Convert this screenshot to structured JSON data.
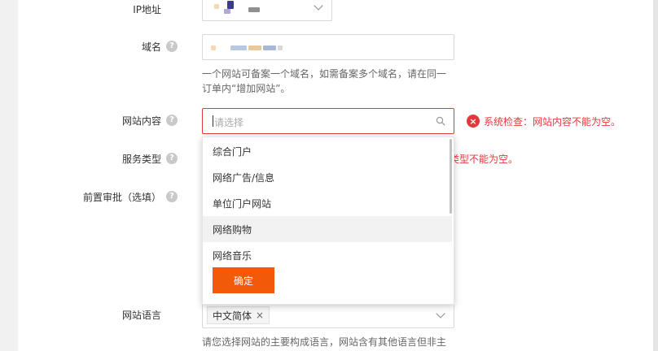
{
  "form": {
    "ip": {
      "label": "IP地址"
    },
    "domain": {
      "label": "域名",
      "hint_line1": "一个网站可备案一个域名，如需备案多个域名，请在同一",
      "hint_line2": "订单内“增加网站”。"
    },
    "site_content": {
      "label": "网站内容",
      "placeholder": "请选择",
      "error": "系统检查：网站内容不能为空。"
    },
    "service_type": {
      "label": "服务类型",
      "error_partial": "类型不能为空。"
    },
    "pre_approval": {
      "label": "前置审批（选填）"
    },
    "site_language": {
      "label": "网站语言",
      "selected_tag": "中文简体",
      "hint": "请您选择网站的主要构成语言，网站含有其他语言但非主"
    }
  },
  "dropdown": {
    "options": [
      "综合门户",
      "网络广告/信息",
      "单位门户网站",
      "网络购物",
      "网络音乐"
    ],
    "hovered": "网络购物",
    "confirm_label": "确定"
  },
  "icons": {
    "help": "?",
    "error": "×",
    "tag_close": "×"
  },
  "colors": {
    "accent": "#f25a0a",
    "error": "#e4393c"
  }
}
